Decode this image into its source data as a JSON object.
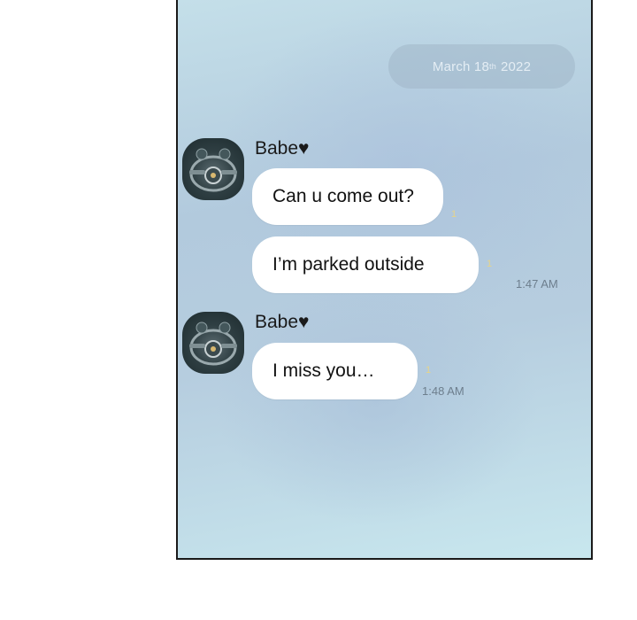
{
  "header": {
    "date_main": "March 18",
    "date_sup": "th",
    "date_year": "2022"
  },
  "messages": [
    {
      "sender": "Babe",
      "heart": "♥",
      "text": "Can u come out?",
      "unread": "1",
      "time": ""
    },
    {
      "sender": "",
      "heart": "",
      "text": "I’m parked outside",
      "unread": "1",
      "time": "1:47 AM"
    },
    {
      "sender": "Babe",
      "heart": "♥",
      "text": "I miss you…",
      "unread": "1",
      "time": "1:48 AM"
    }
  ]
}
